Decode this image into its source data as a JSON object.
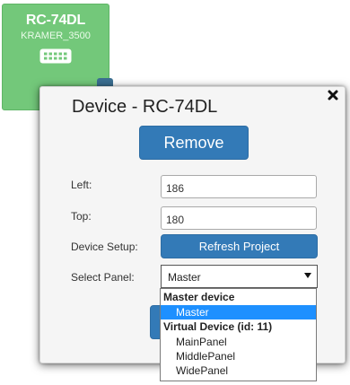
{
  "tile": {
    "title": "RC-74DL",
    "subtitle": "KRAMER_3500",
    "icon": "keypad-icon",
    "color": "#73c87a"
  },
  "dialog": {
    "title": "Device - RC-74DL",
    "close_icon": "close-icon",
    "remove_label": "Remove",
    "left_label": "Left:",
    "left_value": "186",
    "top_label": "Top:",
    "top_value": "180",
    "setup_label": "Device Setup:",
    "refresh_label": "Refresh Project",
    "panel_label": "Select Panel:",
    "panel_selected": "Master",
    "accent_color": "#337ab7"
  },
  "dropdown": {
    "groups": [
      {
        "label": "Master device",
        "options": [
          "Master"
        ]
      },
      {
        "label": "Virtual Device (id: 11)",
        "options": [
          "MainPanel",
          "MiddlePanel",
          "WidePanel"
        ]
      }
    ],
    "highlighted": "Master",
    "highlight_color": "#1e90ff"
  }
}
